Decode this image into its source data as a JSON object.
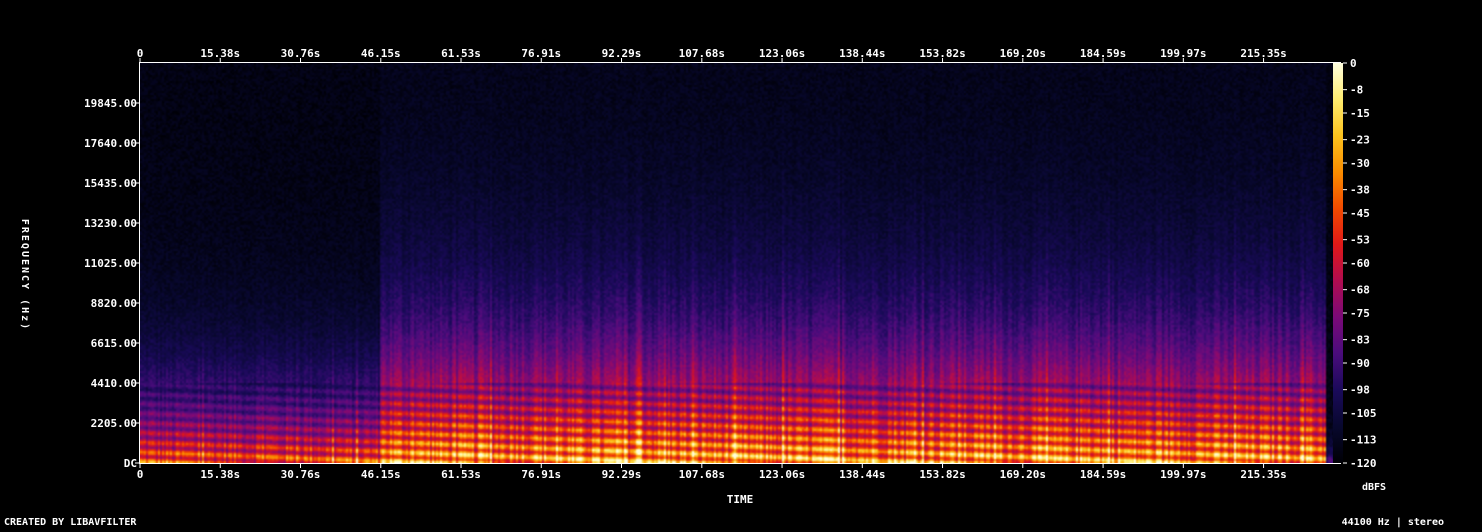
{
  "chart_data": {
    "type": "heatmap",
    "title": "",
    "xlabel": "TIME",
    "ylabel": "FREQUENCY (Hz)",
    "x_ticks": [
      "0",
      "15.38s",
      "30.76s",
      "46.15s",
      "61.53s",
      "76.91s",
      "92.29s",
      "107.68s",
      "123.06s",
      "138.44s",
      "153.82s",
      "169.20s",
      "184.59s",
      "199.97s",
      "215.35s"
    ],
    "y_ticks": [
      "DC",
      "2205.00",
      "4410.00",
      "6615.00",
      "8820.00",
      "11025.00",
      "13230.00",
      "15435.00",
      "17640.00",
      "19845.00"
    ],
    "ylim": [
      0,
      22050
    ],
    "duration_s": 230,
    "colorbar": {
      "label": "dBFS",
      "ticks": [
        "0",
        "-8",
        "-15",
        "-23",
        "-30",
        "-38",
        "-45",
        "-53",
        "-60",
        "-68",
        "-75",
        "-83",
        "-90",
        "-98",
        "-105",
        "-113",
        "-120"
      ],
      "range": [
        -120,
        0
      ],
      "colors": [
        "#000005",
        "#08082e",
        "#1a0a5a",
        "#4a0c7c",
        "#7a0a78",
        "#b00c50",
        "#e01818",
        "#f24a00",
        "#fa8c00",
        "#fcc21e",
        "#ffec70",
        "#ffffe0"
      ]
    },
    "energy_profile": {
      "description_free": true,
      "segments": [
        {
          "t": [
            0,
            46
          ],
          "fmax_hz": 8000,
          "level": 0.75
        },
        {
          "t": [
            46,
            227
          ],
          "fmax_hz": 13000,
          "level": 0.9
        },
        {
          "t": [
            227,
            230
          ],
          "fmax_hz": 2000,
          "level": 0.3
        }
      ]
    }
  },
  "footer": {
    "left": "CREATED BY LIBAVFILTER",
    "right": "44100 Hz | stereo"
  }
}
